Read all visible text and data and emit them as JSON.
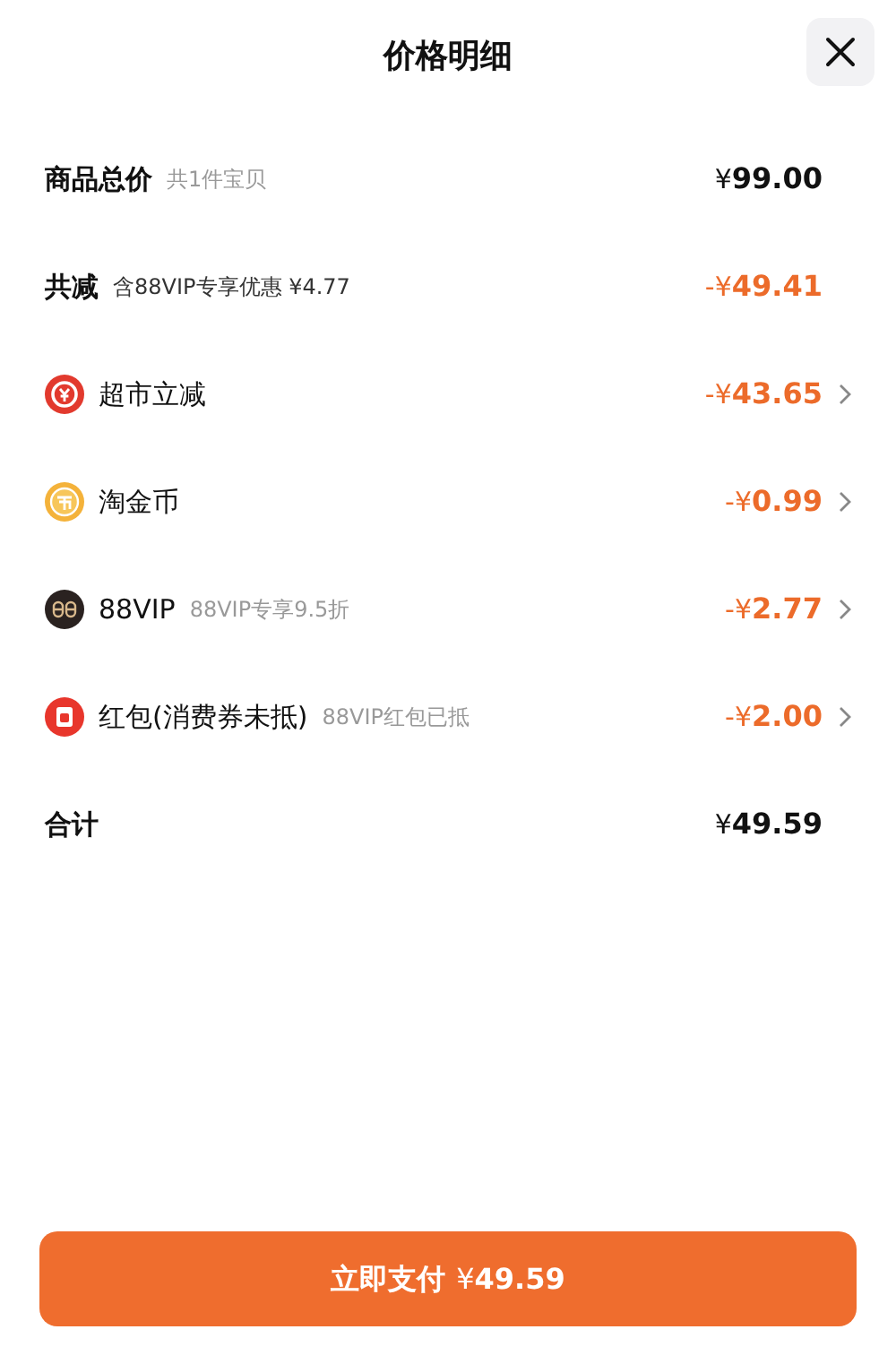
{
  "title": "价格明细",
  "rows": [
    {
      "label": "商品总价",
      "bold": true,
      "note": "共1件宝贝",
      "amount": {
        "prefix": "¥",
        "int": "99",
        "dec": ".00"
      },
      "highlight": false,
      "chevron": false
    },
    {
      "label": "共减",
      "bold": true,
      "note": "含88VIP专享优惠 ¥4.77",
      "amount": {
        "prefix": "-¥",
        "int": "49",
        "dec": ".41"
      },
      "highlight": true,
      "chevron": false
    },
    {
      "kind": "coupon",
      "label": "超市立减",
      "bold": false,
      "amount": {
        "prefix": "-¥",
        "int": "43",
        "dec": ".65"
      },
      "highlight": true,
      "chevron": true
    },
    {
      "kind": "coin",
      "label": "淘金币",
      "bold": false,
      "amount": {
        "prefix": "-¥",
        "int": "0",
        "dec": ".99"
      },
      "highlight": true,
      "chevron": true
    },
    {
      "kind": "vip",
      "label": "88VIP",
      "bold": false,
      "note": "88VIP专享9.5折",
      "amount": {
        "prefix": "-¥",
        "int": "2",
        "dec": ".77"
      },
      "highlight": true,
      "chevron": true
    },
    {
      "kind": "packet",
      "label": "红包(消费券未抵)",
      "bold": false,
      "note": "88VIP红包已抵",
      "amount": {
        "prefix": "-¥",
        "int": "2",
        "dec": ".00"
      },
      "highlight": true,
      "chevron": true
    },
    {
      "label": "合计",
      "bold": true,
      "amount": {
        "prefix": "¥",
        "int": "49",
        "dec": ".59"
      },
      "highlight": false,
      "chevron": false
    }
  ],
  "pay_button": {
    "label": "立即支付",
    "amount": {
      "prefix": "¥",
      "int": "49",
      "dec": ".59"
    }
  }
}
